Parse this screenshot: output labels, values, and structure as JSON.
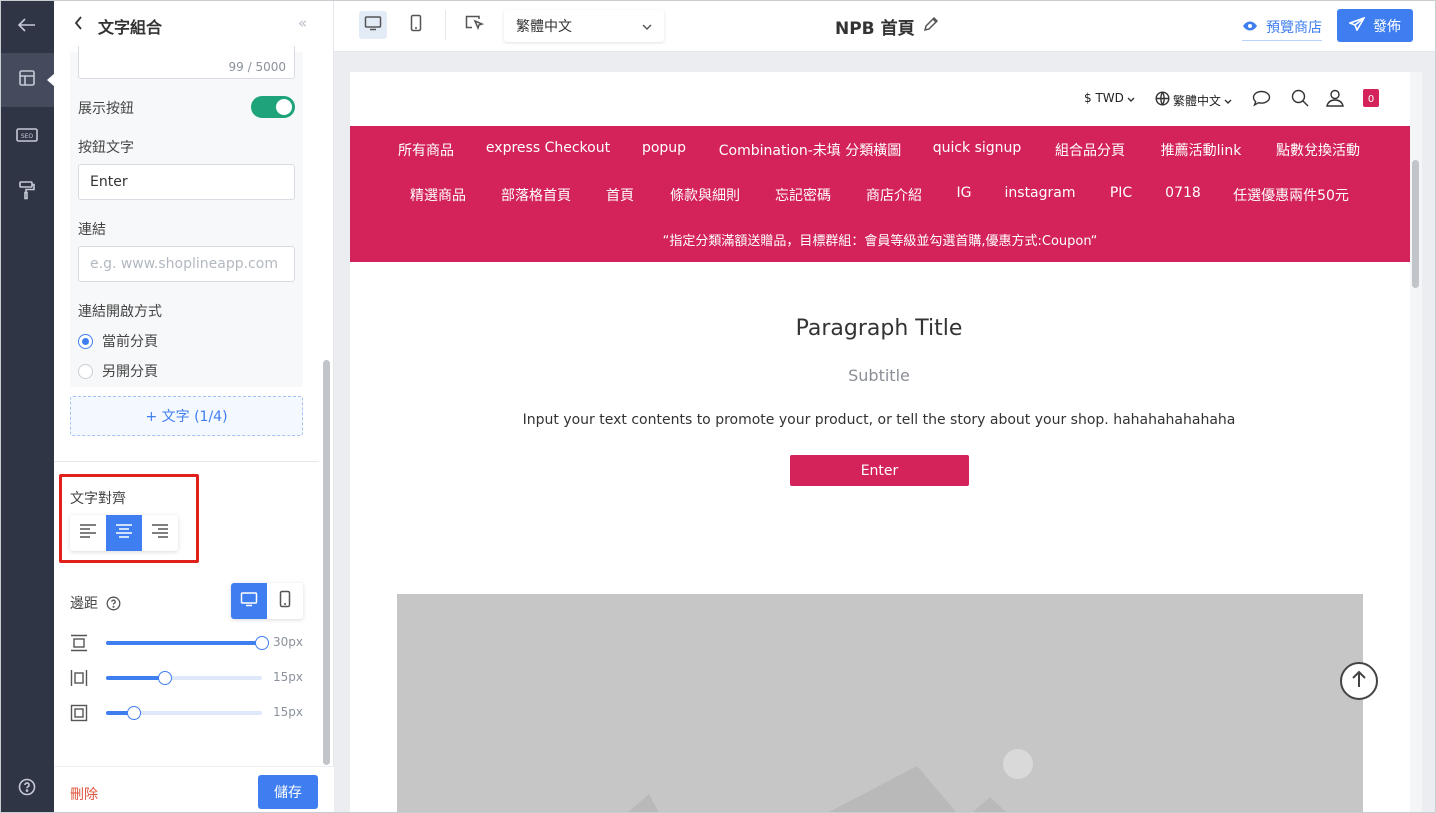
{
  "rail": {
    "items": [
      {
        "icon": "back-arrow-icon"
      },
      {
        "icon": "layout-icon",
        "active": true
      },
      {
        "icon": "seo-icon",
        "text": "SEO"
      },
      {
        "icon": "paint-roller-icon"
      },
      {
        "icon": "help-icon"
      }
    ]
  },
  "panel": {
    "title": "文字組合",
    "char_count": "99 / 5000",
    "show_button_label": "展示按鈕",
    "show_button_on": true,
    "button_text_label": "按鈕文字",
    "button_text_value": "Enter",
    "link_label": "連結",
    "link_placeholder": "e.g. www.shoplineapp.com",
    "link_open_label": "連結開啟方式",
    "radio_current": "當前分頁",
    "radio_new": "另開分頁",
    "add_text": "+ 文字 (1/4)",
    "align_label": "文字對齊",
    "align_selected": "center",
    "padding_label": "邊距",
    "padding_device_selected": "desktop",
    "sliders": [
      {
        "icon": "padding-vertical-icon",
        "value": "30px",
        "fraction": 1.0
      },
      {
        "icon": "padding-horizontal-icon",
        "value": "15px",
        "fraction": 0.38
      },
      {
        "icon": "padding-all-icon",
        "value": "15px",
        "fraction": 0.18
      }
    ],
    "delete": "刪除",
    "save": "儲存"
  },
  "topbar": {
    "language": "繁體中文",
    "page_title": "NPB 首頁",
    "preview": "預覽商店",
    "publish": "發佈"
  },
  "site": {
    "currency": "$ TWD",
    "language": "繁體中文",
    "cart_count": "0",
    "nav_row1": [
      "所有商品",
      "express Checkout",
      "popup",
      "Combination-未填 分類橫圖",
      "quick signup",
      "組合品分頁",
      "推薦活動link",
      "點數兌換活動"
    ],
    "nav_row2": [
      "精選商品",
      "部落格首頁",
      "首頁",
      "條款與細則",
      "忘記密碼",
      "商店介紹",
      "IG",
      "instagram",
      "PIC",
      "0718",
      "任選優惠兩件50元"
    ],
    "promo": "“指定分類滿額送贈品，目標群組：會員等級並勾選首購,優惠方式:Coupon“",
    "paragraph_title": "Paragraph Title",
    "subtitle": "Subtitle",
    "body": "Input your text contents to promote your product, or tell the story about your shop. hahahahahahaha",
    "button": "Enter"
  },
  "colors": {
    "brand_pink": "#d4235a",
    "accent_blue": "#3f7ef0",
    "toggle_green": "#1fa37b",
    "rail_dark": "#2f3545",
    "highlight_red": "#e0211b"
  }
}
